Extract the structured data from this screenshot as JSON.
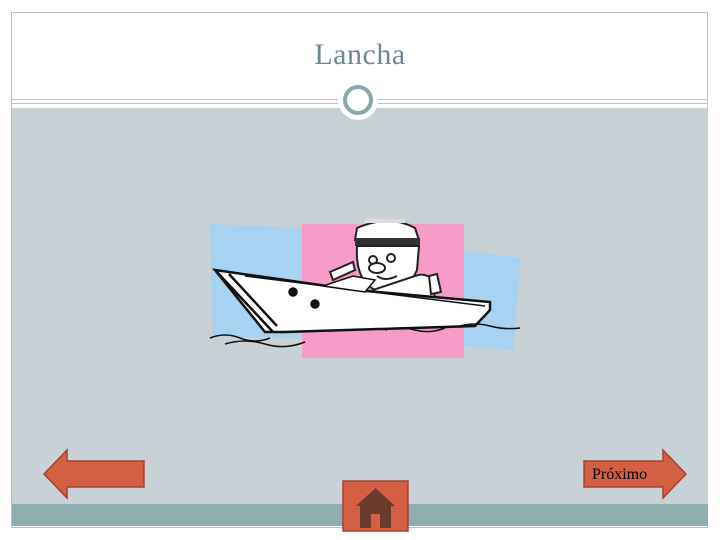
{
  "slide": {
    "title": "Lancha"
  },
  "illustration": {
    "name": "sailor-in-motorboat-clipart",
    "colors": {
      "pink": "#f79bc9",
      "blue": "#a8d2f2"
    }
  },
  "nav": {
    "back_icon": "left-arrow-icon",
    "next_label": "Próximo",
    "home_icon": "home-icon"
  },
  "colors": {
    "arrow_fill": "#d35f45",
    "arrow_stroke": "#a34530",
    "content_bg": "#c8d1d6",
    "bar": "#8faeb0",
    "title": "#6e8790"
  }
}
